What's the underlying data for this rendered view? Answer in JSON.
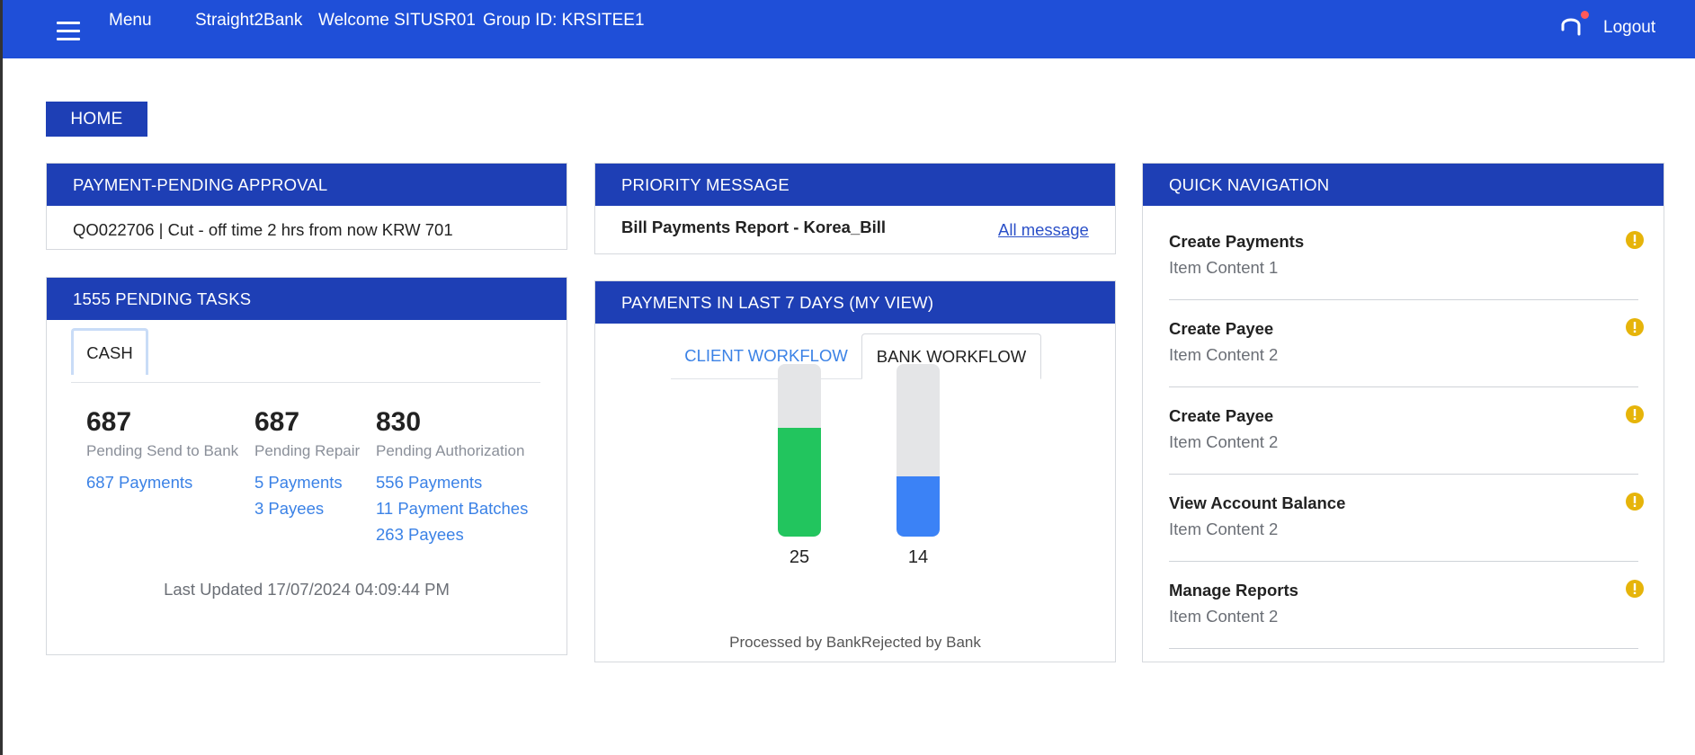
{
  "header": {
    "menu_label": "Menu",
    "brand": "Straight2Bank",
    "welcome": "Welcome SITUSR01",
    "group_id": "Group ID: KRSITEE1",
    "logout_label": "Logout",
    "icons": [
      "hamburger-icon",
      "headset-icon"
    ],
    "bar_color": "#1f4fd8"
  },
  "breadcrumb": {
    "home_label": "HOME"
  },
  "payment_pending": {
    "title": "PAYMENT-PENDING APPROVAL",
    "text": "QO022706 | Cut - off time 2 hrs from now KRW 701"
  },
  "pending_tasks": {
    "title": "1555 PENDING TASKS",
    "tab_label": "CASH",
    "stats": [
      {
        "value": "687",
        "label": "Pending Send to Bank",
        "links": [
          "687 Payments"
        ]
      },
      {
        "value": "687",
        "label": "Pending Repair",
        "links": [
          "5 Payments",
          "3 Payees"
        ]
      },
      {
        "value": "830",
        "label": "Pending Authorization",
        "links": [
          "556 Payments",
          "11 Payment Batches",
          "263 Payees"
        ]
      }
    ],
    "last_updated": "Last Updated 17/07/2024 04:09:44 PM"
  },
  "priority_message": {
    "title": "PRIORITY MESSAGE",
    "message": "Bill Payments Report - Korea_Bill",
    "all_link": "All message"
  },
  "payments_7_days": {
    "title": "PAYMENTS IN LAST 7 DAYS (MY VIEW)",
    "tabs": [
      "CLIENT WORKFLOW",
      "BANK WORKFLOW"
    ],
    "active_tab": "BANK WORKFLOW",
    "caption": "Processed by BankRejected by Bank"
  },
  "chart_data": {
    "type": "bar",
    "categories": [
      "Processed by Bank",
      "Rejected by Bank"
    ],
    "values": [
      25,
      14
    ],
    "colors": [
      "#22c55e",
      "#3b82f6"
    ],
    "track_color": "#e4e5e7",
    "fill_fractions": [
      0.63,
      0.35
    ]
  },
  "quick_navigation": {
    "title": "QUICK NAVIGATION",
    "items": [
      {
        "title": "Create Payments",
        "content": "Item Content 1"
      },
      {
        "title": "Create Payee",
        "content": "Item Content 2"
      },
      {
        "title": "Create Payee",
        "content": "Item Content 2"
      },
      {
        "title": "View Account Balance",
        "content": "Item Content 2"
      },
      {
        "title": "Manage Reports",
        "content": "Item Content 2"
      }
    ],
    "icon": "info-warning-icon",
    "icon_color": "#e6b40a"
  }
}
